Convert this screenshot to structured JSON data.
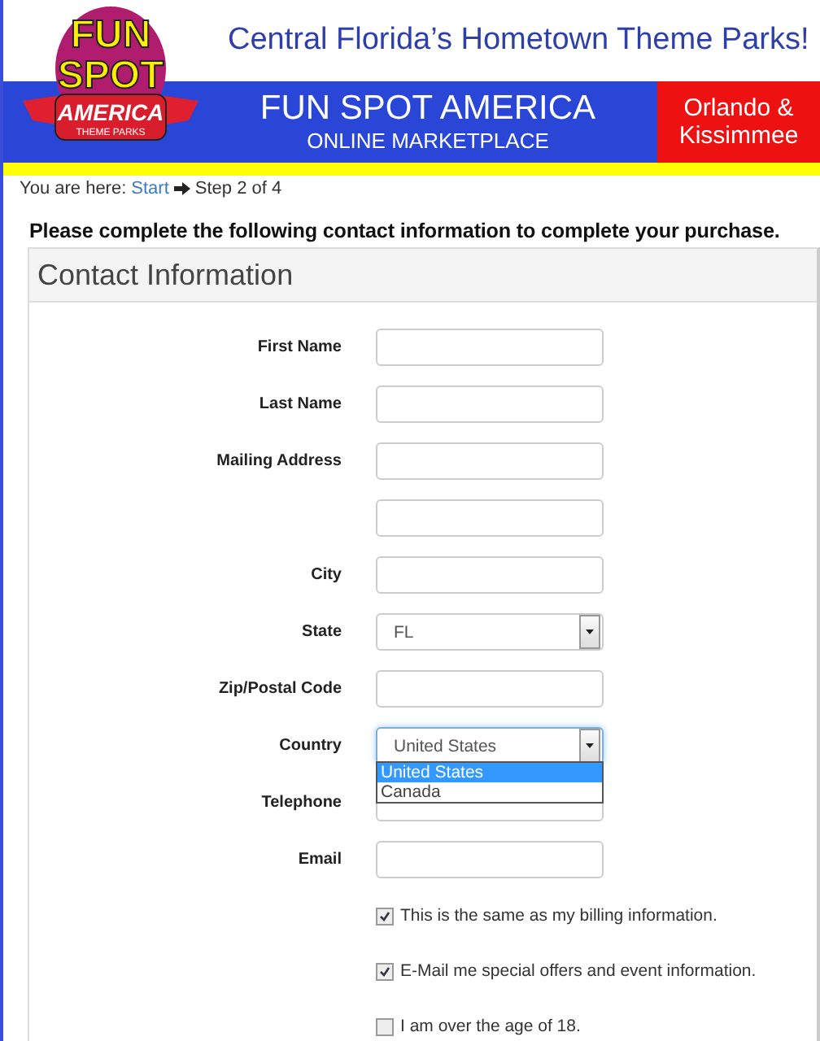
{
  "logo": {
    "line_1": "FUN",
    "line_2": "SPOT",
    "line_3": "AMERICA",
    "line_4": "THEME PARKS"
  },
  "tagline": "Central Florida’s Hometown Theme Parks!",
  "banner": {
    "title": "FUN SPOT AMERICA",
    "subtitle": "ONLINE MARKETPLACE",
    "location": "Orlando & Kissimmee"
  },
  "breadcrumb": {
    "prefix": "You are here:",
    "link": "Start",
    "current": "Step 2 of 4"
  },
  "instruction": "Please complete the following contact information to complete your purchase.",
  "panel": {
    "title": "Contact Information",
    "fields": [
      {
        "kind": "text",
        "label": "First Name"
      },
      {
        "kind": "text",
        "label": "Last Name"
      },
      {
        "kind": "text",
        "label": "Mailing Address"
      },
      {
        "kind": "text"
      },
      {
        "kind": "text",
        "label": "City"
      },
      {
        "kind": "select",
        "label": "State",
        "value": "FL"
      },
      {
        "kind": "text",
        "label": "Zip/Postal Code"
      },
      {
        "kind": "select",
        "label": "Country",
        "value": "United States",
        "focused": true,
        "options": [
          {
            "label": "United States",
            "selected": true
          },
          {
            "label": "Canada",
            "selected": false
          }
        ]
      },
      {
        "kind": "text",
        "label": "Telephone"
      },
      {
        "kind": "text",
        "label": "Email"
      }
    ],
    "checkboxes": [
      {
        "label": "This is the same as my billing information.",
        "checked": true
      },
      {
        "label": "E-Mail me special offers and event information.",
        "checked": true
      },
      {
        "label": "I am over the age of 18.",
        "checked": false
      }
    ]
  }
}
